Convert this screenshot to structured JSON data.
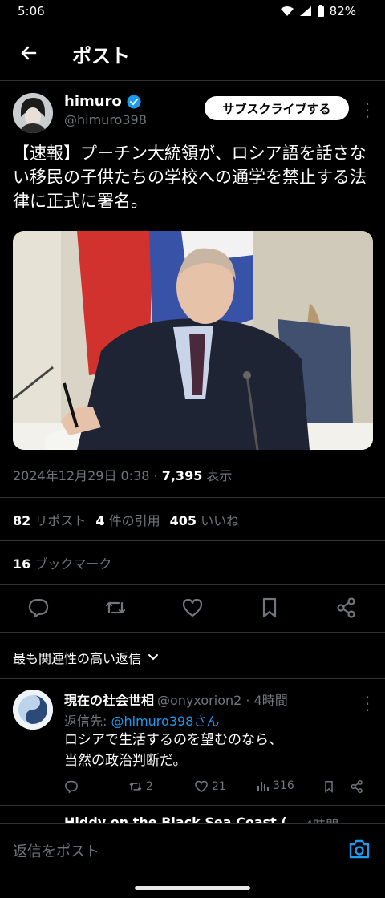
{
  "status_bar": {
    "time": "5:06",
    "battery": "82%"
  },
  "header": {
    "title": "ポスト"
  },
  "post": {
    "author_name": "himuro",
    "author_handle": "@himuro398",
    "subscribe_label": "サブスクライブする",
    "text": "【速報】プーチン大統領が、ロシア語を話さない移民の子供たちの学校への通学を禁止する法律に正式に署名。",
    "datetime": "2024年12月29日 0:38 · ",
    "views_count": "7,395",
    "views_label": " 表示",
    "reposts_count": "82",
    "reposts_label": "リポスト",
    "quotes_count": "4",
    "quotes_label": "件の引用",
    "likes_count": "405",
    "likes_label": "いいね",
    "bookmarks_count": "16",
    "bookmarks_label": "ブックマーク"
  },
  "replies_sort": {
    "label": "最も関連性の高い返信"
  },
  "reply": {
    "name": "現在の社会世相",
    "handle": "@onyxorion2 · 4時間",
    "reply_to_prefix": "返信先: ",
    "reply_to_handle": "@himuro398さん",
    "text_line1": "ロシアで生活するのを望むのなら、",
    "text_line2": "当然の政治判断だ。",
    "retweets": "2",
    "likes": "21",
    "views": "316"
  },
  "next_reply": {
    "name": "Hiddy on the Black Sea Coast (",
    "time": "4時間"
  },
  "composer": {
    "placeholder": "返信をポスト"
  },
  "colors": {
    "accent": "#1d9bf0",
    "background": "#000000",
    "muted": "#71767b"
  }
}
